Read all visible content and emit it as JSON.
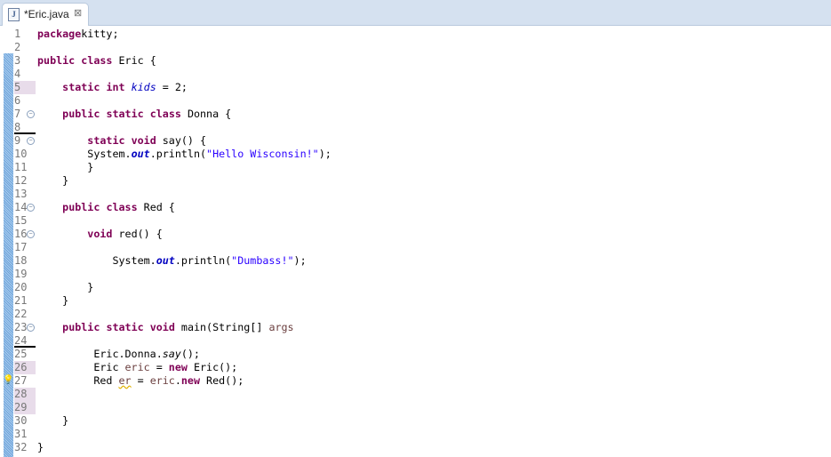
{
  "tab": {
    "title": "*Eric.java",
    "icon": "java-file-icon",
    "close": "⊠"
  },
  "colors": {
    "keyword": "#7f0055",
    "string": "#2a00ff",
    "field": "#0000c0",
    "local": "#6a3e3e"
  },
  "lines": [
    {
      "n": "1",
      "t": [
        [
          "kw",
          "package"
        ],
        [
          "",
          "kitty;"
        ]
      ]
    },
    {
      "n": "2",
      "t": []
    },
    {
      "n": "3",
      "t": [
        [
          "kw",
          "public"
        ],
        [
          "",
          " "
        ],
        [
          "kw",
          "class"
        ],
        [
          "",
          " Eric {"
        ]
      ]
    },
    {
      "n": "4",
      "t": []
    },
    {
      "n": "5",
      "t": [
        [
          "",
          "    "
        ],
        [
          "kw",
          "static"
        ],
        [
          "",
          " "
        ],
        [
          "kw",
          "int"
        ],
        [
          "",
          " "
        ],
        [
          "fld",
          "kids"
        ],
        [
          "",
          " = 2;"
        ]
      ]
    },
    {
      "n": "6",
      "t": []
    },
    {
      "n": "7",
      "t": [
        [
          "",
          "    "
        ],
        [
          "kw",
          "public"
        ],
        [
          "",
          " "
        ],
        [
          "kw",
          "static"
        ],
        [
          "",
          " "
        ],
        [
          "kw",
          "class"
        ],
        [
          "",
          " Donna {"
        ]
      ]
    },
    {
      "n": "8",
      "t": []
    },
    {
      "n": "9",
      "t": [
        [
          "",
          "        "
        ],
        [
          "kw",
          "static"
        ],
        [
          "",
          " "
        ],
        [
          "kw",
          "void"
        ],
        [
          "",
          " say() {"
        ]
      ]
    },
    {
      "n": "10",
      "t": [
        [
          "",
          "        System."
        ],
        [
          "sfld",
          "out"
        ],
        [
          "",
          ".println("
        ],
        [
          "str",
          "\"Hello Wisconsin!\""
        ],
        [
          "",
          ");"
        ]
      ]
    },
    {
      "n": "11",
      "t": [
        [
          "",
          "        }"
        ]
      ]
    },
    {
      "n": "12",
      "t": [
        [
          "",
          "    }"
        ]
      ]
    },
    {
      "n": "13",
      "t": []
    },
    {
      "n": "14",
      "t": [
        [
          "",
          "    "
        ],
        [
          "kw",
          "public"
        ],
        [
          "",
          " "
        ],
        [
          "kw",
          "class"
        ],
        [
          "",
          " Red {"
        ]
      ]
    },
    {
      "n": "15",
      "t": []
    },
    {
      "n": "16",
      "t": [
        [
          "",
          "        "
        ],
        [
          "kw",
          "void"
        ],
        [
          "",
          " red() {"
        ]
      ]
    },
    {
      "n": "17",
      "t": []
    },
    {
      "n": "18",
      "t": [
        [
          "",
          "            System."
        ],
        [
          "sfld",
          "out"
        ],
        [
          "",
          ".println("
        ],
        [
          "str",
          "\"Dumbass!\""
        ],
        [
          "",
          ");"
        ]
      ]
    },
    {
      "n": "19",
      "t": []
    },
    {
      "n": "20",
      "t": [
        [
          "",
          "        }"
        ]
      ]
    },
    {
      "n": "21",
      "t": [
        [
          "",
          "    }"
        ]
      ]
    },
    {
      "n": "22",
      "t": []
    },
    {
      "n": "23",
      "t": [
        [
          "",
          "    "
        ],
        [
          "kw",
          "public"
        ],
        [
          "",
          " "
        ],
        [
          "kw",
          "static"
        ],
        [
          "",
          " "
        ],
        [
          "kw",
          "void"
        ],
        [
          "",
          " main(String[] "
        ],
        [
          "var",
          "args"
        ],
        [
          ") {"
        ]
      ]
    },
    {
      "n": "24",
      "t": []
    },
    {
      "n": "25",
      "t": [
        [
          "",
          "         Eric.Donna."
        ],
        [
          "mth",
          "say"
        ],
        [
          "",
          "();"
        ]
      ]
    },
    {
      "n": "26",
      "t": [
        [
          "",
          "         Eric "
        ],
        [
          "var",
          "eric"
        ],
        [
          "",
          " = "
        ],
        [
          "kw",
          "new"
        ],
        [
          "",
          " Eric();"
        ]
      ]
    },
    {
      "n": "27",
      "t": [
        [
          "",
          "         Red "
        ],
        [
          "var warn",
          "er"
        ],
        [
          "",
          " = "
        ],
        [
          "var",
          "eric"
        ],
        [
          "",
          "."
        ],
        [
          "kw",
          "new"
        ],
        [
          "",
          " Red();"
        ]
      ]
    },
    {
      "n": "28",
      "t": []
    },
    {
      "n": "29",
      "t": []
    },
    {
      "n": "30",
      "t": [
        [
          "",
          "    }"
        ]
      ]
    },
    {
      "n": "31",
      "t": []
    },
    {
      "n": "32",
      "t": [
        [
          "",
          "}"
        ]
      ]
    }
  ]
}
